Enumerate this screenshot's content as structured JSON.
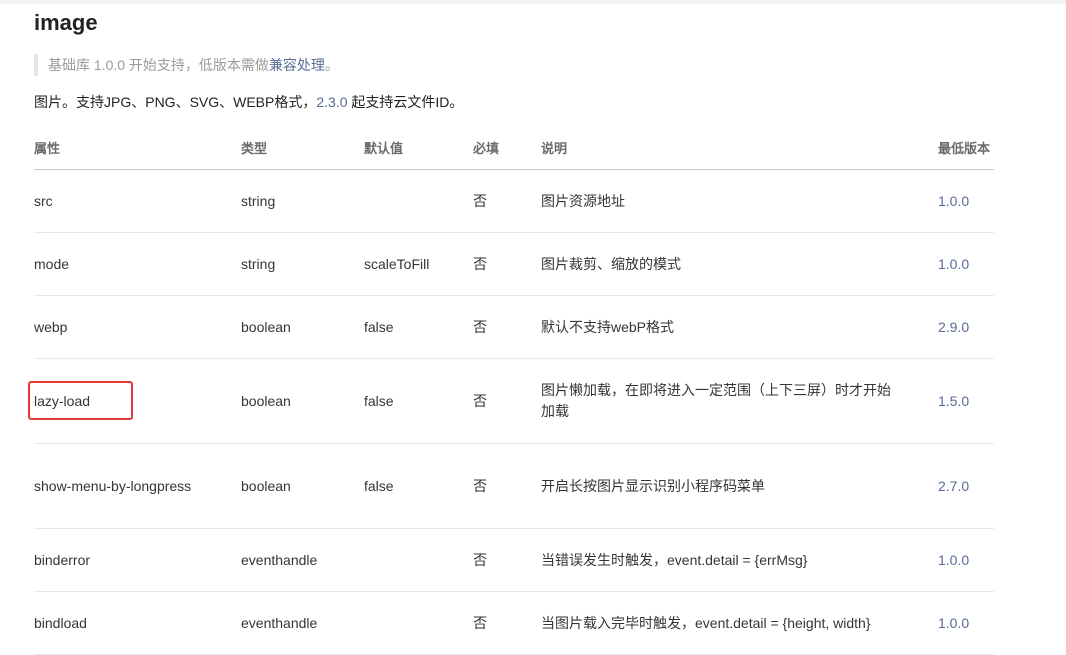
{
  "title": "image",
  "note": {
    "prefix": "基础库 1.0.0 开始支持，低版本需做",
    "link": "兼容处理",
    "suffix": "。"
  },
  "description": {
    "prefix": "图片。支持JPG、PNG、SVG、WEBP格式，",
    "link": "2.3.0",
    "suffix": " 起支持云文件ID。"
  },
  "table": {
    "headers": [
      "属性",
      "类型",
      "默认值",
      "必填",
      "说明",
      "最低版本"
    ],
    "rows": [
      {
        "attr": "src",
        "type": "string",
        "default": "",
        "required": "否",
        "explain": "图片资源地址",
        "version": "1.0.0"
      },
      {
        "attr": "mode",
        "type": "string",
        "default": "scaleToFill",
        "required": "否",
        "explain": "图片裁剪、缩放的模式",
        "version": "1.0.0"
      },
      {
        "attr": "webp",
        "type": "boolean",
        "default": "false",
        "required": "否",
        "explain": "默认不支持webP格式",
        "version": "2.9.0"
      },
      {
        "attr": "lazy-load",
        "type": "boolean",
        "default": "false",
        "required": "否",
        "explain": "图片懒加载，在即将进入一定范围（上下三屏）时才开始加载",
        "version": "1.5.0"
      },
      {
        "attr": "show-menu-by-longpress",
        "type": "boolean",
        "default": "false",
        "required": "否",
        "explain": "开启长按图片显示识别小程序码菜单",
        "version": "2.7.0"
      },
      {
        "attr": "binderror",
        "type": "eventhandle",
        "default": "",
        "required": "否",
        "explain": "当错误发生时触发，event.detail = {errMsg}",
        "version": "1.0.0"
      },
      {
        "attr": "bindload",
        "type": "eventhandle",
        "default": "",
        "required": "否",
        "explain": "当图片载入完毕时触发，event.detail = {height, width}",
        "version": "1.0.0"
      }
    ]
  },
  "colors": {
    "link": "#576b95",
    "highlight": "#e53935"
  }
}
